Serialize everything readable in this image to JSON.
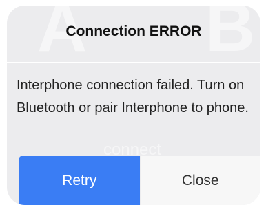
{
  "dialog": {
    "title": "Connection ERROR",
    "message": "Interphone connection failed. Turn on Bluetooth or pair Interphone to phone.",
    "background_letters": [
      "A",
      "B"
    ],
    "background_word": "connect",
    "buttons": {
      "retry_label": "Retry",
      "close_label": "Close"
    },
    "colors": {
      "accent": "#3a7df4",
      "dialog_background": "#ececee"
    }
  }
}
